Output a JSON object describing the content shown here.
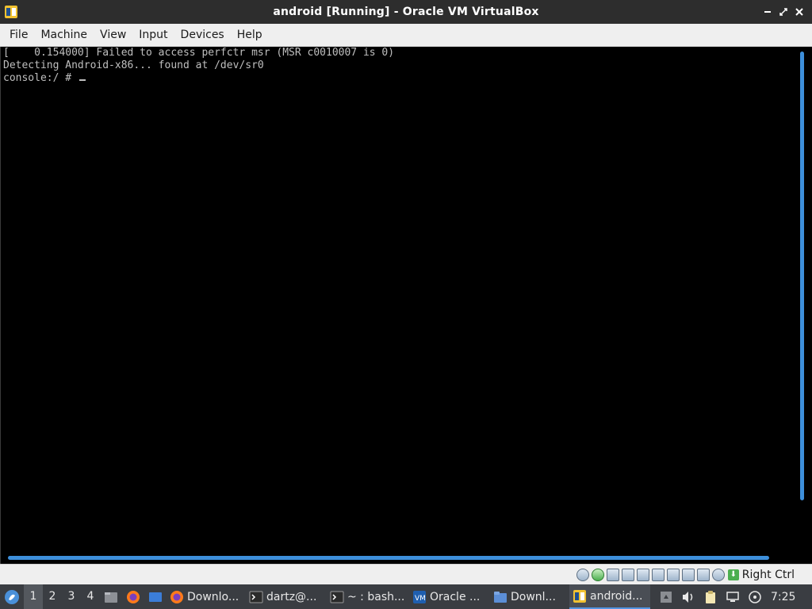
{
  "window": {
    "title": "android [Running] - Oracle VM VirtualBox"
  },
  "menubar": {
    "items": [
      "File",
      "Machine",
      "View",
      "Input",
      "Devices",
      "Help"
    ]
  },
  "console": {
    "lines": [
      "[    0.154000] Failed to access perfctr msr (MSR c0010007 is 0)",
      "Detecting Android-x86... found at /dev/sr0",
      "console:/ # "
    ]
  },
  "statusbar": {
    "icons": [
      "hard-disk-icon",
      "optical-drive-icon",
      "audio-icon",
      "network-icon",
      "usb-icon",
      "shared-folders-icon",
      "display-icon",
      "video-capture-icon",
      "cpu-icon",
      "mouse-integration-icon"
    ],
    "host_key": "Right Ctrl"
  },
  "taskbar": {
    "workspaces": [
      "1",
      "2",
      "3",
      "4"
    ],
    "active_workspace": "1",
    "launchers": [
      "file-manager-icon",
      "firefox-icon",
      "desktop-icon"
    ],
    "tasks": [
      {
        "label": "Downlo...",
        "icon": "firefox-icon",
        "active": false
      },
      {
        "label": "dartz@...",
        "icon": "terminal-icon",
        "active": false
      },
      {
        "label": "~ : bash...",
        "icon": "terminal-icon",
        "active": false
      },
      {
        "label": "Oracle ...",
        "icon": "virtualbox-icon",
        "active": false
      },
      {
        "label": "Downl...",
        "icon": "folder-icon",
        "active": false
      },
      {
        "label": "android...",
        "icon": "virtualbox-icon",
        "active": true
      }
    ],
    "tray": [
      "keyboard-icon",
      "volume-icon",
      "clipboard-icon",
      "network-icon",
      "updates-icon"
    ],
    "clock": "7:25"
  },
  "colors": {
    "titlebar": "#2d2d2d",
    "accent": "#3d8fdb",
    "taskbar": "#3a3d42",
    "console_text": "#bfbfbf"
  }
}
